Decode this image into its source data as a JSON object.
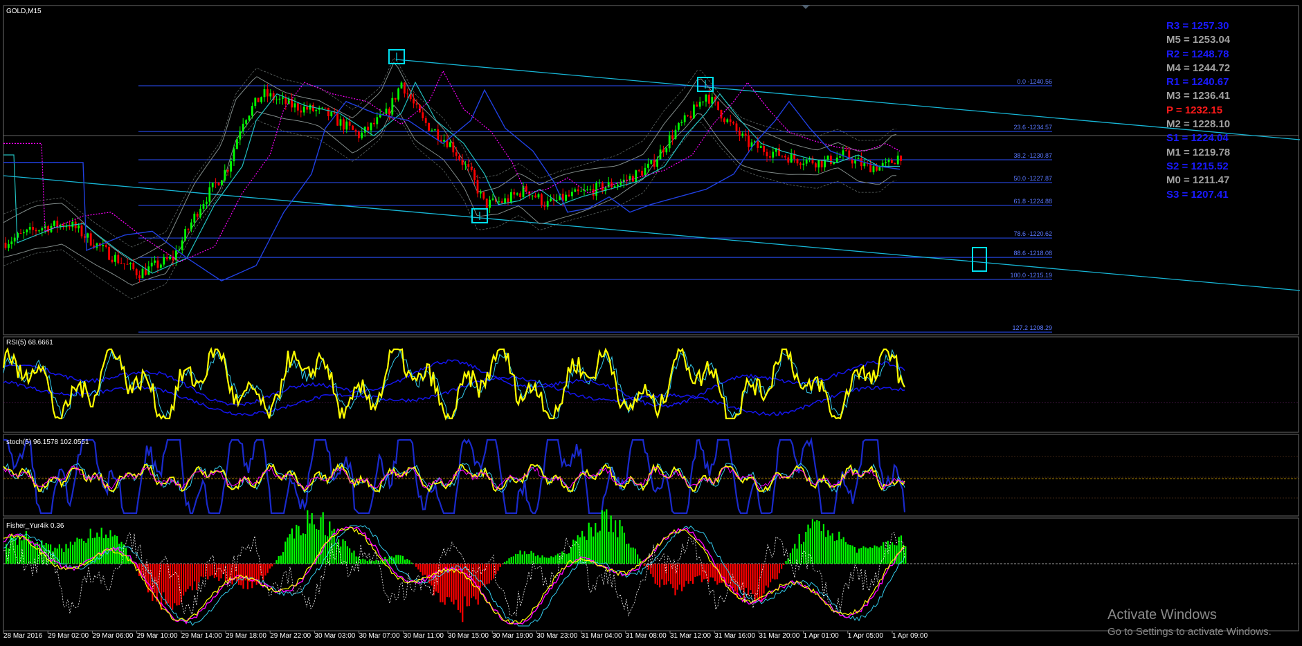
{
  "window": {
    "symbol_label": "GOLD,M15"
  },
  "pivots": [
    {
      "label": "R3 = 1257.30",
      "color": "#1a1aff"
    },
    {
      "label": "M5 = 1253.04",
      "color": "#a0a0a0"
    },
    {
      "label": "R2 = 1248.78",
      "color": "#1a1aff"
    },
    {
      "label": "M4 = 1244.72",
      "color": "#a0a0a0"
    },
    {
      "label": "R1 = 1240.67",
      "color": "#1a1aff"
    },
    {
      "label": "M3 = 1236.41",
      "color": "#a0a0a0"
    },
    {
      "label": "P = 1232.15",
      "color": "#ff1a1a"
    },
    {
      "label": "M2 = 1228.10",
      "color": "#a0a0a0"
    },
    {
      "label": "S1 = 1224.04",
      "color": "#1a1aff"
    },
    {
      "label": "M1 = 1219.78",
      "color": "#a0a0a0"
    },
    {
      "label": "S2 = 1215.52",
      "color": "#1a1aff"
    },
    {
      "label": "M0 = 1211.47",
      "color": "#a0a0a0"
    },
    {
      "label": "S3 = 1207.41",
      "color": "#1a1aff"
    }
  ],
  "fib_levels": [
    {
      "label": "0.0 -1240.56",
      "price": 1240.56
    },
    {
      "label": "23.6 -1234.57",
      "price": 1234.57
    },
    {
      "label": "38.2 -1230.87",
      "price": 1230.87
    },
    {
      "label": "50.0 -1227.87",
      "price": 1227.87
    },
    {
      "label": "61.8 -1224.88",
      "price": 1224.88
    },
    {
      "label": "78.6 -1220.62",
      "price": 1220.62
    },
    {
      "label": "88.6 -1218.08",
      "price": 1218.08
    },
    {
      "label": "100.0 -1215.19",
      "price": 1215.19
    },
    {
      "label": "127.2 1208.29",
      "price": 1208.29
    }
  ],
  "indicators": {
    "rsi_label": "RSI(5) 68.6661",
    "stoch_label": "stoch(5) 96.1578 102.0551",
    "fisher_label": "Fisher_Yur4ik 0.36"
  },
  "time_axis": [
    "28 Mar 2016",
    "29 Mar 02:00",
    "29 Mar 06:00",
    "29 Mar 10:00",
    "29 Mar 14:00",
    "29 Mar 18:00",
    "29 Mar 22:00",
    "30 Mar 03:00",
    "30 Mar 07:00",
    "30 Mar 11:00",
    "30 Mar 15:00",
    "30 Mar 19:00",
    "30 Mar 23:00",
    "31 Mar 04:00",
    "31 Mar 08:00",
    "31 Mar 12:00",
    "31 Mar 16:00",
    "31 Mar 20:00",
    "1 Apr 01:00",
    "1 Apr 05:00",
    "1 Apr 09:00"
  ],
  "windows_notice": {
    "title": "Activate Windows",
    "subtitle": "Go to Settings to activate Windows."
  },
  "colors": {
    "background": "#000000",
    "bull": "#00ff00",
    "bear": "#ff0000",
    "trendline": "#17b6d6",
    "fib": "#2b4fff",
    "rsi_main": "#ffff00",
    "band": "#1515ee",
    "magenta": "#ff00ff",
    "cyan_box": "#00e0f0"
  }
}
